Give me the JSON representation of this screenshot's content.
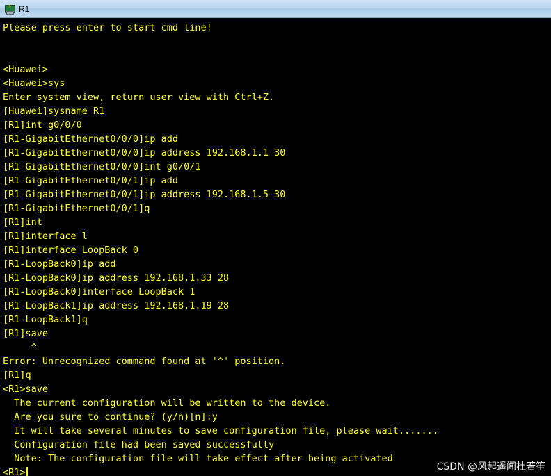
{
  "window": {
    "title": "R1",
    "icon": "router-console-icon"
  },
  "terminal": {
    "lines": [
      "Please press enter to start cmd line!",
      "",
      "",
      "<Huawei>",
      "<Huawei>sys",
      "Enter system view, return user view with Ctrl+Z.",
      "[Huawei]sysname R1",
      "[R1]int g0/0/0",
      "[R1-GigabitEthernet0/0/0]ip add",
      "[R1-GigabitEthernet0/0/0]ip address 192.168.1.1 30",
      "[R1-GigabitEthernet0/0/0]int g0/0/1",
      "[R1-GigabitEthernet0/0/1]ip add",
      "[R1-GigabitEthernet0/0/1]ip address 192.168.1.5 30",
      "[R1-GigabitEthernet0/0/1]q",
      "[R1]int",
      "[R1]interface l",
      "[R1]interface LoopBack 0",
      "[R1-LoopBack0]ip add",
      "[R1-LoopBack0]ip address 192.168.1.33 28",
      "[R1-LoopBack0]interface LoopBack 1",
      "[R1-LoopBack1]ip address 192.168.1.19 28",
      "[R1-LoopBack1]q",
      "[R1]save",
      "     ^",
      "Error: Unrecognized command found at '^' position.",
      "[R1]q",
      "<R1>save",
      "  The current configuration will be written to the device.",
      "  Are you sure to continue? (y/n)[n]:y",
      "  It will take several minutes to save configuration file, please wait.......",
      "  Configuration file had been saved successfully",
      "  Note: The configuration file will take effect after being activated"
    ],
    "prompt": "<R1>",
    "text_color": "#ffff2b",
    "background_color": "#000000"
  },
  "watermark": {
    "text": "CSDN @风起遥闻杜若笙"
  }
}
